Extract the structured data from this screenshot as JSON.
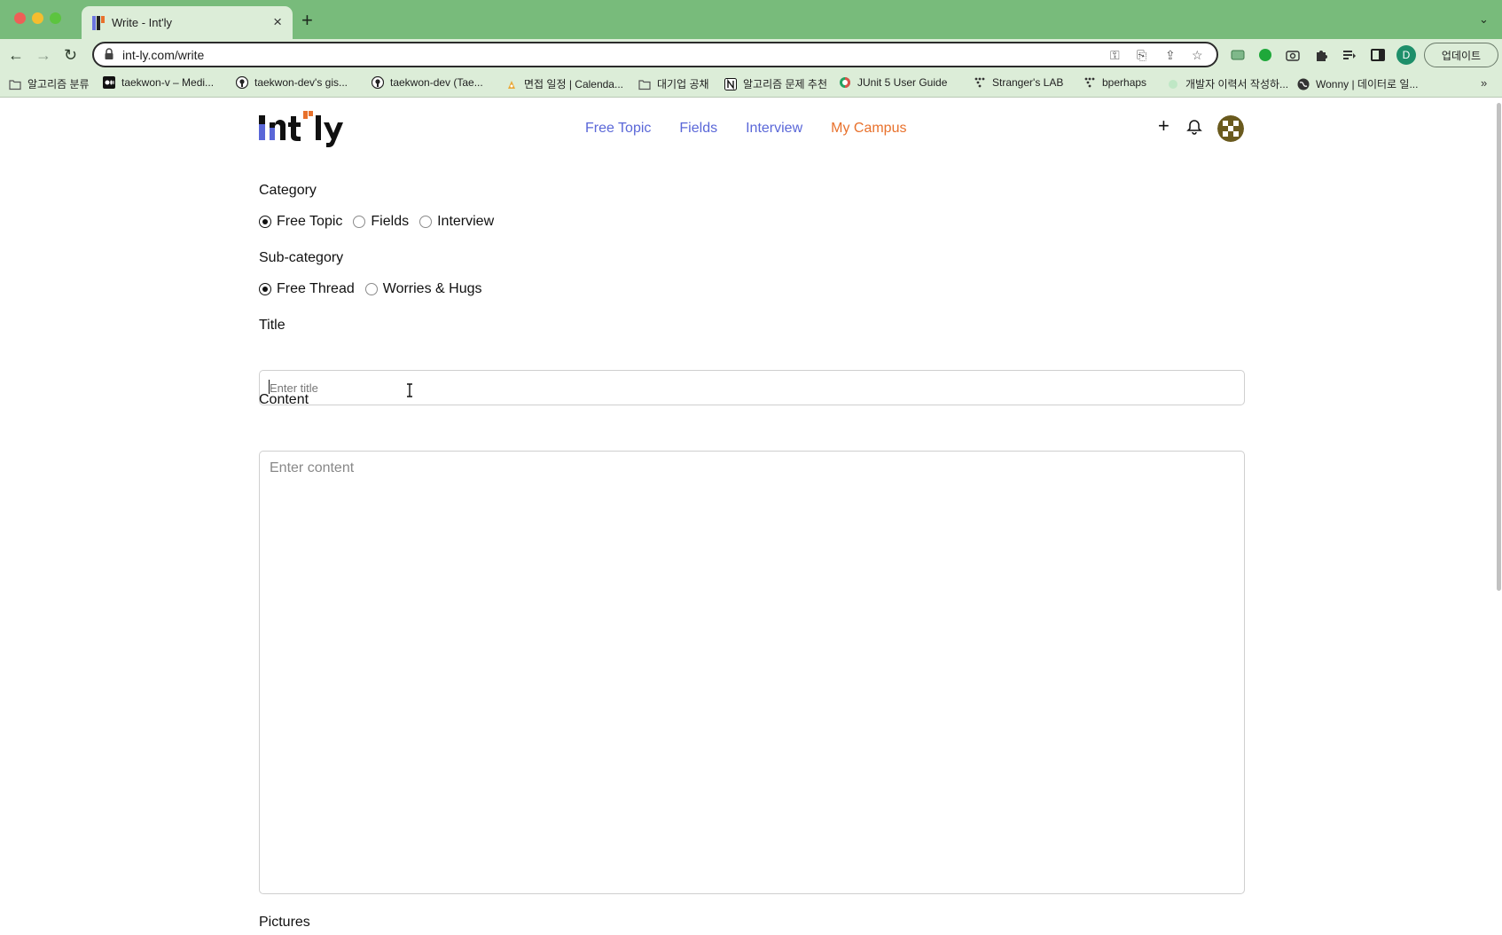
{
  "browser": {
    "tab": {
      "title": "Write - Int'ly"
    },
    "omnibox": {
      "url": "int-ly.com/write"
    },
    "profile_initial": "D",
    "update_label": "업데이트",
    "bookmarks": [
      {
        "label": "알고리즘 분류",
        "icon": "folder-icon"
      },
      {
        "label": "taekwon-v – Medi...",
        "icon": "medium-icon"
      },
      {
        "label": "taekwon-dev's gis...",
        "icon": "github-icon"
      },
      {
        "label": "taekwon-dev (Tae...",
        "icon": "github-icon"
      },
      {
        "label": "면접 일정 | Calenda...",
        "icon": "calendar-icon"
      },
      {
        "label": "대기업 공채",
        "icon": "folder-icon"
      },
      {
        "label": "알고리즘 문제 추천",
        "icon": "notion-icon"
      },
      {
        "label": "JUnit 5 User Guide",
        "icon": "junit-icon"
      },
      {
        "label": "Stranger's LAB",
        "icon": "dots-icon"
      },
      {
        "label": "bperhaps",
        "icon": "dots-icon"
      },
      {
        "label": "개발자 이력서 작성하...",
        "icon": "leaf-icon"
      },
      {
        "label": "Wonny | 데이터로 일...",
        "icon": "globe-icon"
      }
    ]
  },
  "header": {
    "logo_text": "Int'ly",
    "nav": [
      "Free Topic",
      "Fields",
      "Interview",
      "My Campus"
    ]
  },
  "form": {
    "category_label": "Category",
    "category_options": [
      "Free Topic",
      "Fields",
      "Interview"
    ],
    "category_selected": "Free Topic",
    "subcategory_label": "Sub-category",
    "subcategory_options": [
      "Free Thread",
      "Worries & Hugs"
    ],
    "subcategory_selected": "Free Thread",
    "title_label": "Title",
    "title_placeholder": "Enter title",
    "content_label": "Content",
    "content_placeholder": "Enter content",
    "pictures_label": "Pictures"
  },
  "colors": {
    "tab_bar": "#78bb7b",
    "toolbar": "#dcedd8",
    "nav_link": "#5a67d8",
    "nav_link_active": "#e8712c"
  }
}
